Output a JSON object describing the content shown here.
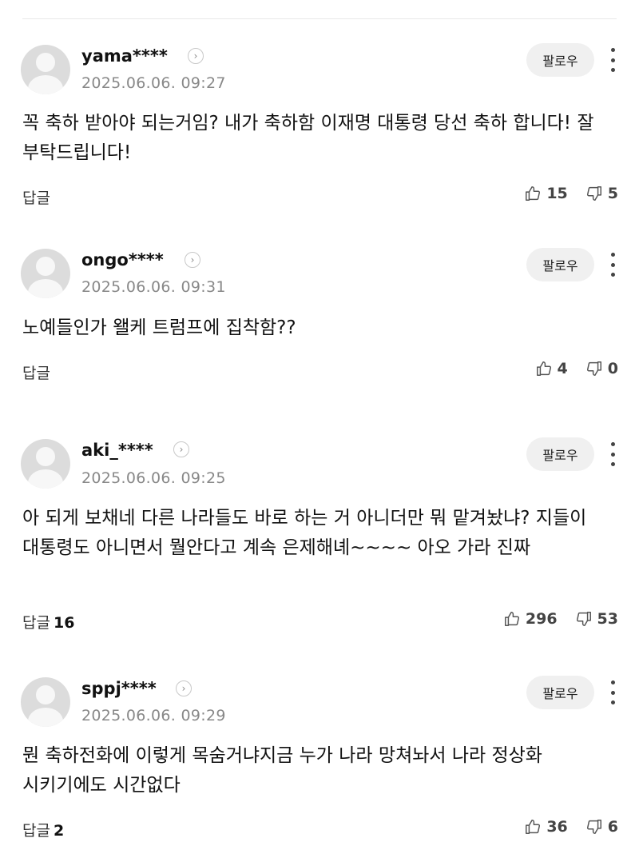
{
  "comments": [
    {
      "username": "yama****",
      "timestamp": "2025.06.06. 09:27",
      "follow_label": "팔로우",
      "text": "꼭 축하 받아야 되는거임? 내가 축하함 이재명 대통령 당선 축하 합니다! 잘 부탁드립니다!",
      "reply_label": "답글",
      "reply_count": "",
      "likes": "15",
      "dislikes": "5"
    },
    {
      "username": "ongo****",
      "timestamp": "2025.06.06. 09:31",
      "follow_label": "팔로우",
      "text": "노예들인가 왤케 트럼프에 집착함??",
      "reply_label": "답글",
      "reply_count": "",
      "likes": "4",
      "dislikes": "0"
    },
    {
      "username": "aki_****",
      "timestamp": "2025.06.06. 09:25",
      "follow_label": "팔로우",
      "text": "아 되게 보채네 다른 나라들도 바로 하는 거 아니더만 뭐 맡겨놨냐? 지들이 대통령도 아니면서 뭘안다고 계속 은제해녜~~~~ 아오 가라 진짜",
      "reply_label": "답글",
      "reply_count": "16",
      "likes": "296",
      "dislikes": "53"
    },
    {
      "username": "sppj****",
      "timestamp": "2025.06.06. 09:29",
      "follow_label": "팔로우",
      "text": "뭔 축하전화에 이렇게 목숨거냐지금 누가 나라 망쳐놔서 나라 정상화 시키기에도 시간없다",
      "reply_label": "답글",
      "reply_count": "2",
      "likes": "36",
      "dislikes": "6"
    }
  ]
}
